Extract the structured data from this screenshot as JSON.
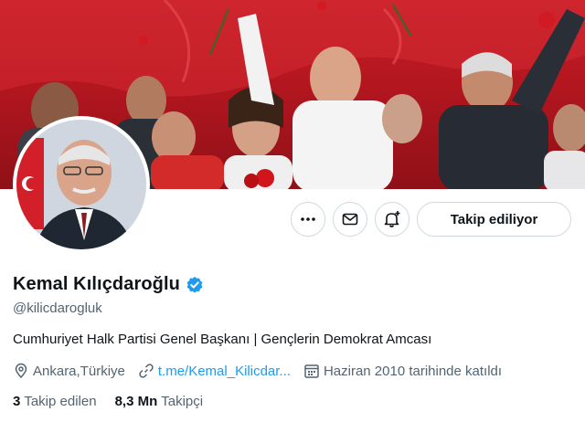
{
  "banner": {
    "description_icon": "crowd-photo"
  },
  "avatar": {
    "icon": "profile-photo"
  },
  "actions": {
    "more_icon": "more-icon",
    "message_icon": "envelope-icon",
    "notify_icon": "bell-plus-icon",
    "follow_label": "Takip ediliyor"
  },
  "profile": {
    "display_name": "Kemal Kılıçdaroğlu",
    "verified_icon": "verified-badge-icon",
    "handle": "@kilicdarogluk",
    "bio": "Cumhuriyet Halk Partisi Genel Başkanı | Gençlerin Demokrat Amcası",
    "location": "Ankara,Türkiye",
    "link": "t.me/Kemal_Kilicdar...",
    "joined": "Haziran 2010 tarihinde katıldı"
  },
  "stats": {
    "following_count": "3",
    "following_label": "Takip edilen",
    "followers_count": "8,3 Mn",
    "followers_label": "Takipçi"
  },
  "colors": {
    "accent": "#1d9bf0",
    "banner_red": "#c8202a",
    "text": "#0f1419",
    "muted": "#536471"
  }
}
